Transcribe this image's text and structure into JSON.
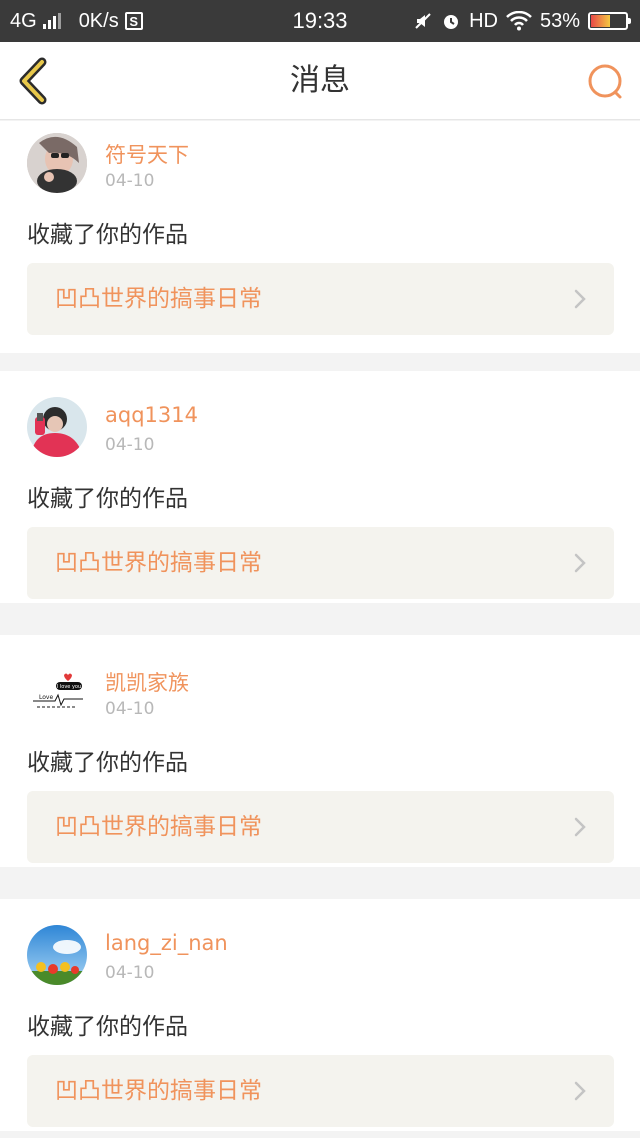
{
  "status_bar": {
    "network": "4G",
    "speed": "0K/s",
    "s_badge": "S",
    "time": "19:33",
    "hd": "HD",
    "battery_percent": "53%",
    "battery_level": 0.53
  },
  "nav": {
    "title": "消息",
    "accent_color": "#f0935c"
  },
  "messages": [
    {
      "username": "符号天下",
      "date": "04-10",
      "action": "收藏了你的作品",
      "work_title": "凹凸世界的搞事日常"
    },
    {
      "username": "aqq1314",
      "date": "04-10",
      "action": "收藏了你的作品",
      "work_title": "凹凸世界的搞事日常"
    },
    {
      "username": "凯凯家族",
      "date": "04-10",
      "action": "收藏了你的作品",
      "work_title": "凹凸世界的搞事日常"
    },
    {
      "username": "lang_zi_nan",
      "date": "04-10",
      "action": "收藏了你的作品",
      "work_title": "凹凸世界的搞事日常"
    }
  ],
  "avatar3_text": {
    "line1": "I love you",
    "line2": "Love"
  }
}
